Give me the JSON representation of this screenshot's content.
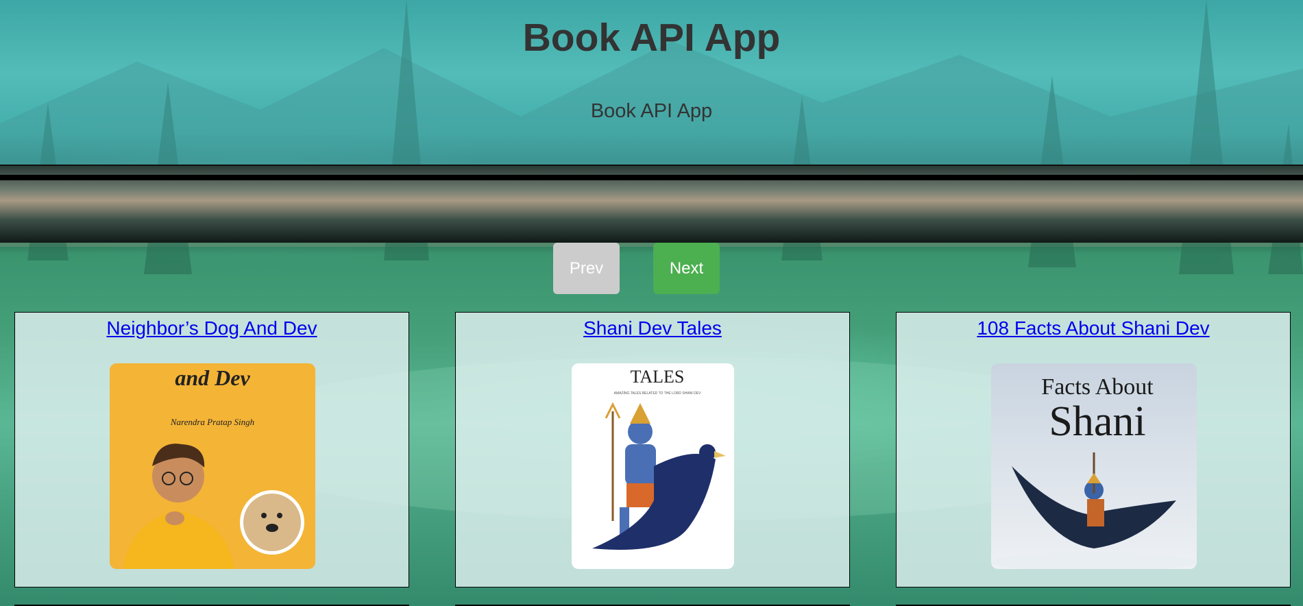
{
  "app": {
    "title": "Book API App",
    "subtitle": "Book API App"
  },
  "pagination": {
    "prev_label": "Prev",
    "next_label": "Next",
    "prev_color": "#cccccc",
    "next_color": "#4caf50"
  },
  "books": [
    {
      "title": "Neighbor’s Dog And Dev",
      "cover": {
        "line1": "and Dev",
        "line2": "Narendra Pratap Singh",
        "bg": "#f4b436"
      }
    },
    {
      "title": "Shani Dev Tales",
      "cover": {
        "line1": "TALES",
        "line2": "AMAZING TALES RELATED TO THE LORD SHANI DEV",
        "bg": "#ffffff"
      }
    },
    {
      "title": "108 Facts About Shani Dev",
      "cover": {
        "line1": "Facts About",
        "line2": "Shani",
        "bg": "#d9dde2"
      }
    }
  ]
}
